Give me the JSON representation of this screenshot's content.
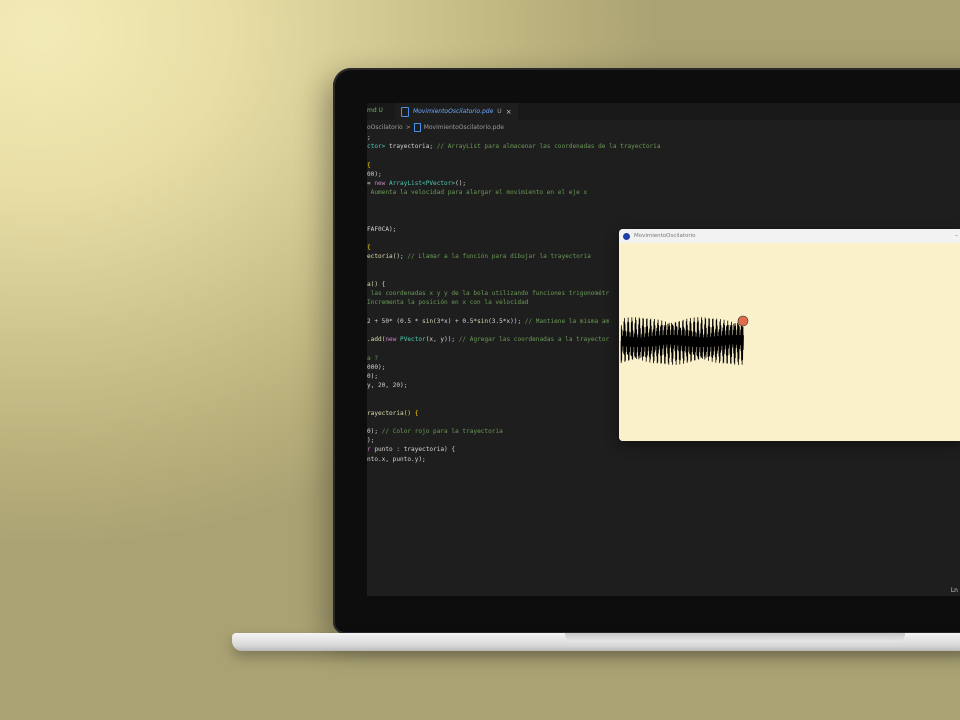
{
  "editor": {
    "prev_tab_label": "md U",
    "active_tab": {
      "label": "MovimientoOscilatorio.pde",
      "modified_marker": "U",
      "close_glyph": "×"
    },
    "breadcrumb": {
      "folder": "oOscilatorio",
      "separator": ">",
      "file": "MovimientoOscilatorio.pde"
    },
    "code_lines": [
      [
        {
          "t": ";",
          "c": "plain"
        }
      ],
      [
        {
          "t": "ctor> ",
          "c": "type"
        },
        {
          "t": "trayectoria; ",
          "c": "plain"
        },
        {
          "t": "// ArrayList para almacenar las coordenadas de la trayectoria",
          "c": "comment"
        }
      ],
      [],
      [
        {
          "t": "{",
          "c": "brace"
        }
      ],
      [
        {
          "t": "00);",
          "c": "plain"
        }
      ],
      [
        {
          "t": "= ",
          "c": "plain"
        },
        {
          "t": "new ",
          "c": "kw"
        },
        {
          "t": "ArrayList<PVector>",
          "c": "type"
        },
        {
          "t": "();",
          "c": "plain"
        }
      ],
      [
        {
          "t": " Aumenta la velocidad para alargar el movimiento en el eje x",
          "c": "comment"
        }
      ],
      [],
      [],
      [],
      [
        {
          "t": "FAF0CA);",
          "c": "plain"
        }
      ],
      [],
      [
        {
          "t": "{",
          "c": "brace"
        }
      ],
      [
        {
          "t": "ectoria",
          "c": "fn"
        },
        {
          "t": "(); ",
          "c": "plain"
        },
        {
          "t": "// Llamar a la función para dibujar la trayectoria",
          "c": "comment"
        }
      ],
      [],
      [],
      [
        {
          "t": "a() {",
          "c": "fn"
        }
      ],
      [
        {
          "t": " las coordenadas x y y de la bola utilizando funciones trigonométr",
          "c": "comment"
        }
      ],
      [
        {
          "t": "Incrementa la posición en x con la velocidad",
          "c": "comment"
        }
      ],
      [],
      [
        {
          "t": "2 + 50* (0.5 * ",
          "c": "plain"
        },
        {
          "t": "sin",
          "c": "fn"
        },
        {
          "t": "(3*x) + 0.5*",
          "c": "plain"
        },
        {
          "t": "sin",
          "c": "fn"
        },
        {
          "t": "(3.5*x)); ",
          "c": "plain"
        },
        {
          "t": "// Mantiene la misma am",
          "c": "comment"
        }
      ],
      [],
      [
        {
          "t": ".add",
          "c": "fn"
        },
        {
          "t": "(",
          "c": "plain"
        },
        {
          "t": "new ",
          "c": "kw"
        },
        {
          "t": "PVector",
          "c": "type"
        },
        {
          "t": "(x, y)); ",
          "c": "plain"
        },
        {
          "t": "// Agregar las coordenadas a la trayector",
          "c": "comment"
        }
      ],
      [],
      [
        {
          "t": "a ?",
          "c": "comment"
        }
      ],
      [
        {
          "t": "000);",
          "c": "plain"
        }
      ],
      [
        {
          "t": "0);",
          "c": "plain"
        }
      ],
      [
        {
          "t": "y, 20, 20);",
          "c": "plain"
        }
      ],
      [],
      [],
      [
        {
          "t": "rayectoria",
          "c": "fn"
        },
        {
          "t": "() {",
          "c": "brace"
        }
      ],
      [],
      [
        {
          "t": "0); ",
          "c": "plain"
        },
        {
          "t": "// Color rojo para la trayectoria",
          "c": "comment"
        }
      ],
      [
        {
          "t": ");",
          "c": "plain"
        }
      ],
      [
        {
          "t": "r ",
          "c": "kw"
        },
        {
          "t": "punto : trayectoria) {",
          "c": "plain"
        }
      ],
      [
        {
          "t": "nto.x, punto.y);",
          "c": "plain"
        }
      ]
    ],
    "status_right": "Ln"
  },
  "sketch_window": {
    "title": "MovimientoOscilatorio",
    "minimize_glyph": "–"
  },
  "colors": {
    "sketch_background": "#FAF0CA",
    "trajectory": "#000000",
    "ball": "#E06C4A"
  }
}
